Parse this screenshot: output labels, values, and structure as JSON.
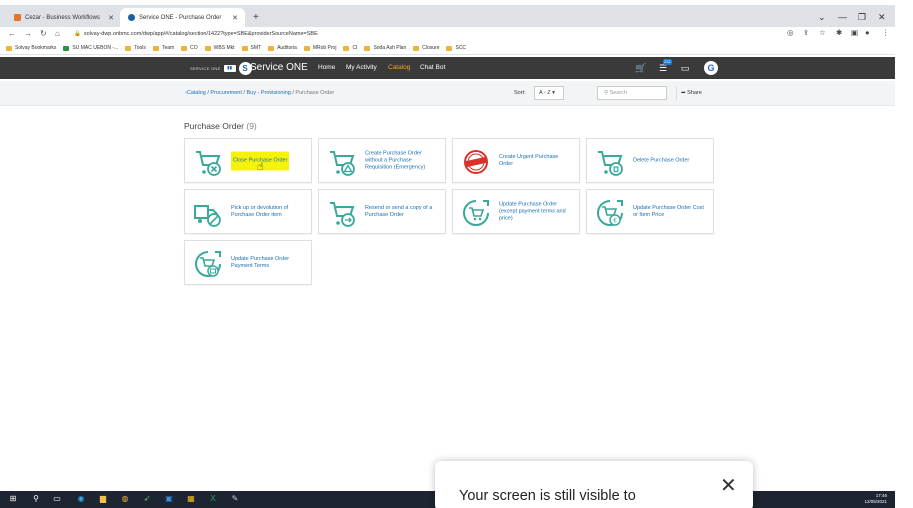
{
  "browser": {
    "tabs": [
      {
        "label": "Cezar - Business Workflows",
        "active": false
      },
      {
        "label": "Service ONE - Purchase Order",
        "active": true
      }
    ],
    "url": "solvay-dwp.onbmc.com/dwp/app/#/catalog/section/1422?type=SBE&providerSourceName=SBE",
    "bookmarks": [
      "Solvay Bookmarks",
      "SU MAC UEBON -...",
      "Tools",
      "Team",
      "CO",
      "WBS Mkt",
      "SMT",
      "Auditoria",
      "MRob Proj",
      "CI",
      "Soda Ash Plan",
      "Closure",
      "SCC"
    ]
  },
  "header": {
    "logo_text": "SERVICE ONE",
    "logo_badge": "S",
    "brand": "Service ONE",
    "nav": [
      {
        "label": "Home",
        "active": false
      },
      {
        "label": "My Activity",
        "active": false
      },
      {
        "label": "Catalog",
        "active": true
      },
      {
        "label": "Chat Bot",
        "active": false
      }
    ],
    "notification_count": "232",
    "avatar_letter": "G"
  },
  "toolbar": {
    "breadcrumb": [
      "Catalog",
      "Procurement",
      "Buy - Provisioning",
      "Purchase Order"
    ],
    "sort_label": "Sort:",
    "sort_value": "A - Z",
    "search_placeholder": "Search",
    "share_label": "Share"
  },
  "content": {
    "heading": "Purchase Order",
    "count": "(9)",
    "cards": [
      {
        "label": "Close Purchase Order",
        "icon": "cart-x-icon",
        "highlight": true
      },
      {
        "label": "Create Purchase Order without a Purchase Requisition (Emergency)",
        "icon": "cart-alert-icon"
      },
      {
        "label": "Create Urgent Purchase Order",
        "icon": "urgent-stamp-icon"
      },
      {
        "label": "Delete Purchase Order",
        "icon": "cart-trash-icon"
      },
      {
        "label": "Pick up or devolution of Purchase Order item",
        "icon": "truck-block-icon"
      },
      {
        "label": "Resend or send a copy of a Purchase Order",
        "icon": "cart-send-icon"
      },
      {
        "label": "Update Purchase Order (except payment terms and price)",
        "icon": "cart-refresh-icon"
      },
      {
        "label": "Update Purchase Order Cost or Item Price",
        "icon": "cart-price-icon"
      },
      {
        "label": "Update Purchase Order Payment Terms",
        "icon": "cart-terms-icon"
      }
    ]
  },
  "notification": {
    "message": "Your screen is still visible to"
  },
  "clock": {
    "time": "17:46",
    "date": "12/05/2021"
  },
  "colors": {
    "accent": "#1a6fb3",
    "header": "#3a3a3a",
    "highlight": "#f6f30b",
    "icon_teal": "#3aa89a"
  }
}
